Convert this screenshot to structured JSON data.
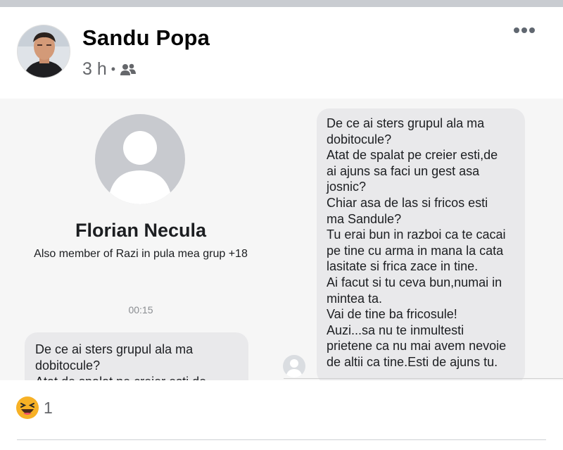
{
  "post": {
    "author": "Sandu Popa",
    "time": "3 h",
    "separator": "•",
    "audience_icon": "friends-icon",
    "options_icon": "more-options-icon"
  },
  "screenshot": {
    "contact_name": "Florian Necula",
    "contact_sub": "Also member of Razi in pula mea grup +18",
    "timestamp": "00:15",
    "left_message_lines": [
      "De ce ai sters grupul ala ma",
      "dobitocule?",
      "Atat de spalat pe creier esti,de"
    ],
    "right_message_lines": [
      "De ce ai sters grupul ala ma",
      "dobitocule?",
      "Atat de spalat pe creier esti,de",
      "ai ajuns sa faci un gest asa",
      "josnic?",
      "Chiar asa de las si fricos esti",
      "ma Sandule?",
      "Tu erai bun in razboi ca te cacai",
      "pe tine cu arma in mana la cata",
      "lasitate si frica zace in tine.",
      "Ai facut si tu ceva bun,numai in",
      "mintea ta.",
      "Vai de tine ba fricosule!",
      "Auzi...sa nu te inmultesti",
      "prietene ca nu mai avem nevoie",
      "de altii ca tine.Esti de ajuns tu."
    ]
  },
  "reactions": {
    "icon": "haha-reaction-icon",
    "count": "1"
  },
  "colors": {
    "bubble": "#e9e9eb",
    "meta_text": "#65676b",
    "top_bar": "#c9ccd1"
  }
}
